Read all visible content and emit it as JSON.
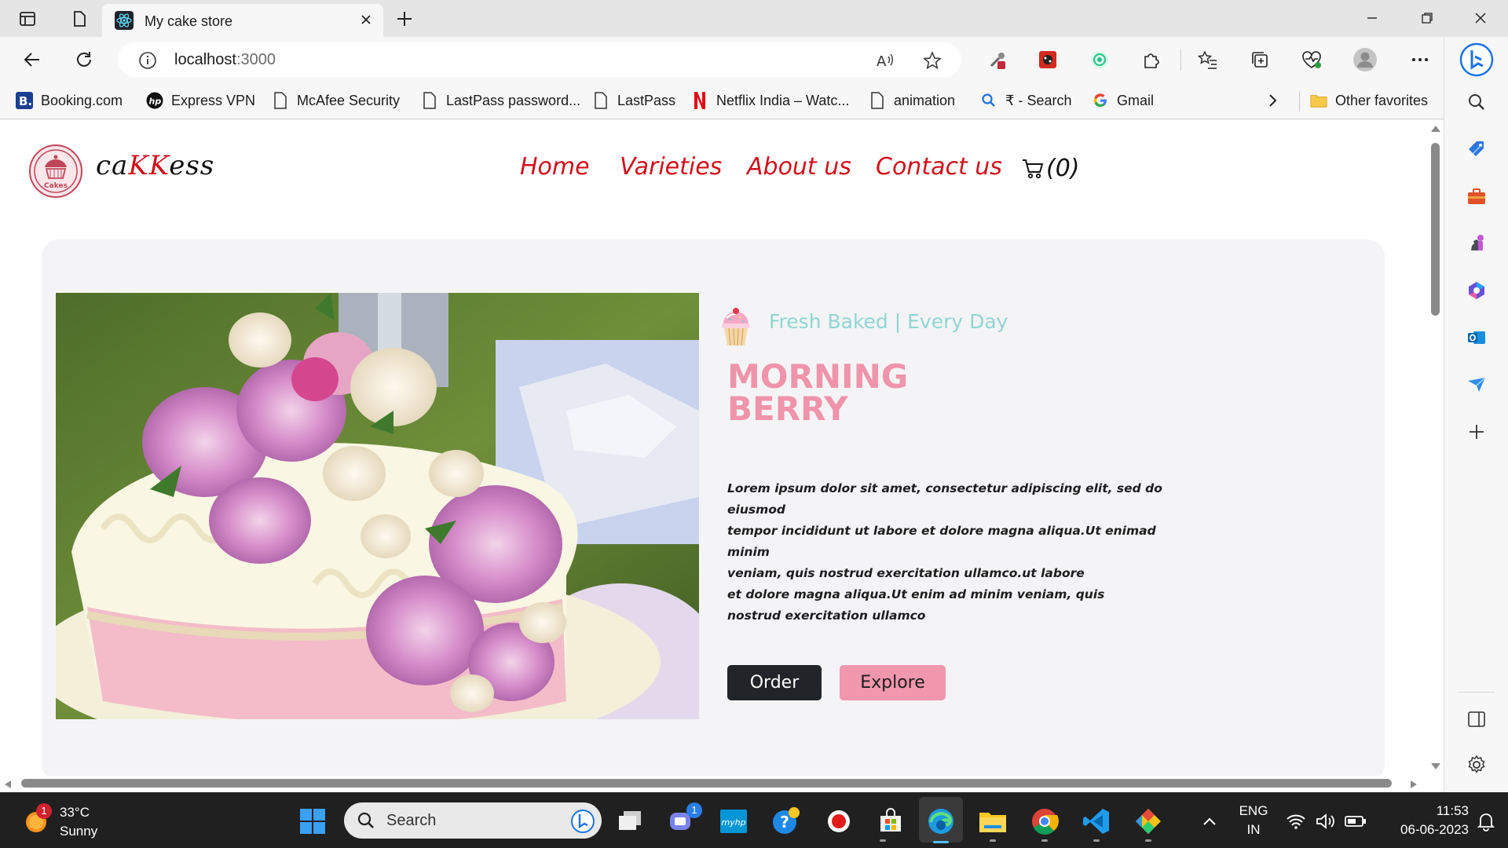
{
  "browser": {
    "tab_title": "My cake store",
    "url_host": "localhost",
    "url_port": ":3000",
    "favorites": [
      {
        "label": "Booking.com",
        "icon": "booking-icon"
      },
      {
        "label": "Express VPN",
        "icon": "hp-icon"
      },
      {
        "label": "McAfee Security",
        "icon": "page-icon"
      },
      {
        "label": "LastPass password...",
        "icon": "page-icon"
      },
      {
        "label": "LastPass",
        "icon": "page-icon"
      },
      {
        "label": "Netflix India – Watc...",
        "icon": "netflix-icon"
      },
      {
        "label": "animation",
        "icon": "page-icon"
      },
      {
        "label": "₹ - Search",
        "icon": "search-icon"
      },
      {
        "label": "Gmail",
        "icon": "google-icon"
      }
    ],
    "other_favorites": "Other favorites"
  },
  "site": {
    "logo_text": "Cakes",
    "brand_pre": "ca",
    "brand_kk": "KK",
    "brand_post": "ess",
    "nav": [
      "Home",
      "Varieties",
      "About us",
      "Contact us"
    ],
    "cart_count": "(0)"
  },
  "hero": {
    "tagline": "Fresh Baked | Every Day",
    "title_line1": "MORNING",
    "title_line2": "BERRY",
    "desc_lines": [
      "Lorem ipsum dolor sit amet, consectetur adipiscing elit, sed do eiusmod",
      "tempor incididunt ut labore et dolore magna aliqua.Ut enimad minim",
      "veniam, quis nostrud exercitation ullamco.ut labore",
      "et dolore magna aliqua.Ut enim ad minim veniam, quis",
      "nostrud exercitation ullamco"
    ],
    "order_label": "Order",
    "explore_label": "Explore"
  },
  "taskbar": {
    "temperature": "33°C",
    "condition": "Sunny",
    "weather_badge": "1",
    "search_placeholder": "Search",
    "teams_badge": "1",
    "lang_line1": "ENG",
    "lang_line2": "IN",
    "time": "11:53",
    "date": "06-06-2023"
  },
  "colors": {
    "brand_red": "#d0101c",
    "title_pink": "#ef94ab",
    "tagline_teal": "#8fd6d2",
    "order_btn": "#212529",
    "explore_btn": "#f096ad"
  }
}
